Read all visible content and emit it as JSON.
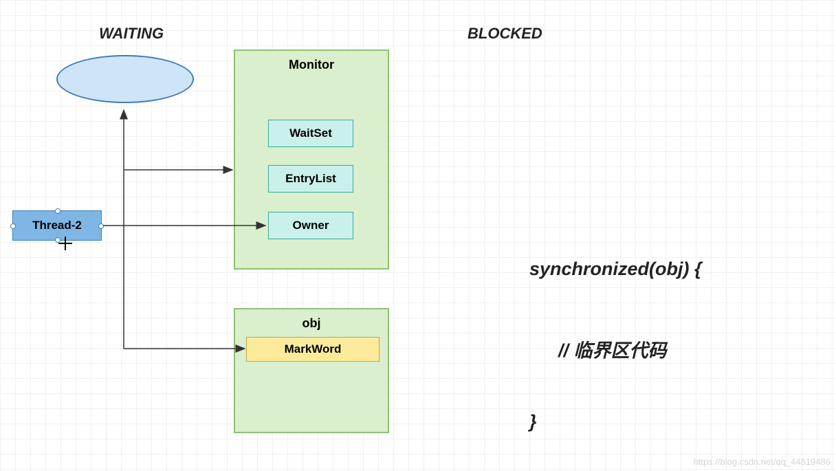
{
  "labels": {
    "waiting": "WAITING",
    "blocked": "BLOCKED"
  },
  "ellipse": {
    "text": ""
  },
  "thread": {
    "label": "Thread-2"
  },
  "monitor": {
    "title": "Monitor",
    "waitset": "WaitSet",
    "entrylist": "EntryList",
    "owner": "Owner"
  },
  "obj": {
    "title": "obj",
    "markword": "MarkWord"
  },
  "code": {
    "line1": "synchronized(obj) {",
    "line2": "// 临界区代码",
    "line3": "}"
  },
  "watermark": "https://blog.csdn.net/qq_44819486"
}
